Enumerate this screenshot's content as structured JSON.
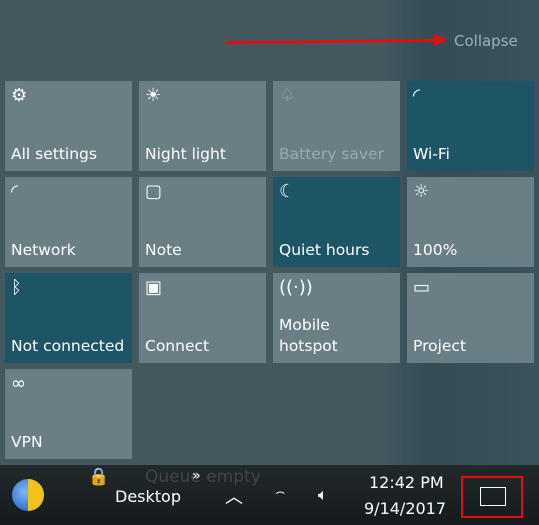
{
  "header": {
    "collapse_label": "Collapse"
  },
  "tiles": [
    {
      "label": "All settings",
      "icon": "gear-icon",
      "glyph": "⚙",
      "state": "normal"
    },
    {
      "label": "Night light",
      "icon": "night-light-icon",
      "glyph": "☀",
      "state": "normal"
    },
    {
      "label": "Battery saver",
      "icon": "leaf-icon",
      "glyph": "♤",
      "state": "disabled"
    },
    {
      "label": "Wi-Fi",
      "icon": "wifi-icon",
      "glyph": "◜",
      "state": "active"
    },
    {
      "label": "Network",
      "icon": "network-icon",
      "glyph": "◜",
      "state": "normal"
    },
    {
      "label": "Note",
      "icon": "note-icon",
      "glyph": "▢",
      "state": "normal"
    },
    {
      "label": "Quiet hours",
      "icon": "moon-icon",
      "glyph": "☾",
      "state": "active"
    },
    {
      "label": "100%",
      "icon": "brightness-icon",
      "glyph": "☼",
      "state": "normal"
    },
    {
      "label": "Not connected",
      "icon": "bluetooth-icon",
      "glyph": "ᛒ",
      "state": "active"
    },
    {
      "label": "Connect",
      "icon": "connect-icon",
      "glyph": "▣",
      "state": "normal"
    },
    {
      "label": "Mobile\nhotspot",
      "icon": "hotspot-icon",
      "glyph": "((·))",
      "state": "normal"
    },
    {
      "label": "Project",
      "icon": "project-icon",
      "glyph": "▭",
      "state": "normal"
    },
    {
      "label": "VPN",
      "icon": "vpn-icon",
      "glyph": "∞",
      "state": "normal"
    }
  ],
  "taskbar": {
    "desktop_label": "Desktop",
    "chevron": "»",
    "queue_text": "Queue empty",
    "time": "12:42 PM",
    "date": "9/14/2017"
  },
  "colors": {
    "active": "#1d5466",
    "tile": "#6a7f85",
    "background": "#44595f",
    "annotation": "#e01010"
  }
}
